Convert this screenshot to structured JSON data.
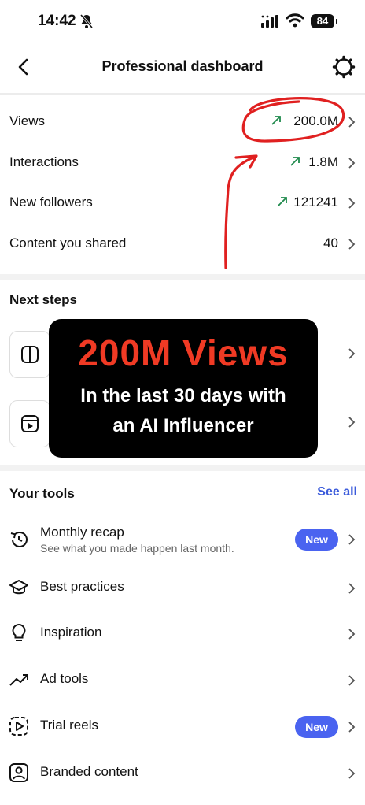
{
  "status_bar": {
    "time": "14:42",
    "battery": "84"
  },
  "header": {
    "title": "Professional dashboard"
  },
  "stats": [
    {
      "label": "Views",
      "value": "200.0M",
      "trend": "up"
    },
    {
      "label": "Interactions",
      "value": "1.8M",
      "trend": "up"
    },
    {
      "label": "New followers",
      "value": "121241",
      "trend": "up"
    },
    {
      "label": "Content you shared",
      "value": "40"
    }
  ],
  "next_steps": {
    "title": "Next steps"
  },
  "overlay": {
    "headline": "200M Views",
    "line1": "In the last 30 days with",
    "line2": "an AI Influencer"
  },
  "tools": {
    "title": "Your tools",
    "see_all": "See all",
    "items": [
      {
        "label": "Monthly recap",
        "subtitle": "See what you made happen last month.",
        "badge": "New",
        "icon": "history-icon"
      },
      {
        "label": "Best practices",
        "icon": "graduation-cap-icon"
      },
      {
        "label": "Inspiration",
        "icon": "lightbulb-icon"
      },
      {
        "label": "Ad tools",
        "icon": "trend-icon"
      },
      {
        "label": "Trial reels",
        "badge": "New",
        "icon": "trial-reel-icon"
      },
      {
        "label": "Branded content",
        "icon": "branded-content-icon"
      }
    ]
  },
  "colors": {
    "trend_green": "#1f8a4c",
    "overlay_red": "#f03a24",
    "annotation_red": "#e02020",
    "badge_blue": "#4a63f0",
    "link_blue": "#3b5bdb"
  }
}
